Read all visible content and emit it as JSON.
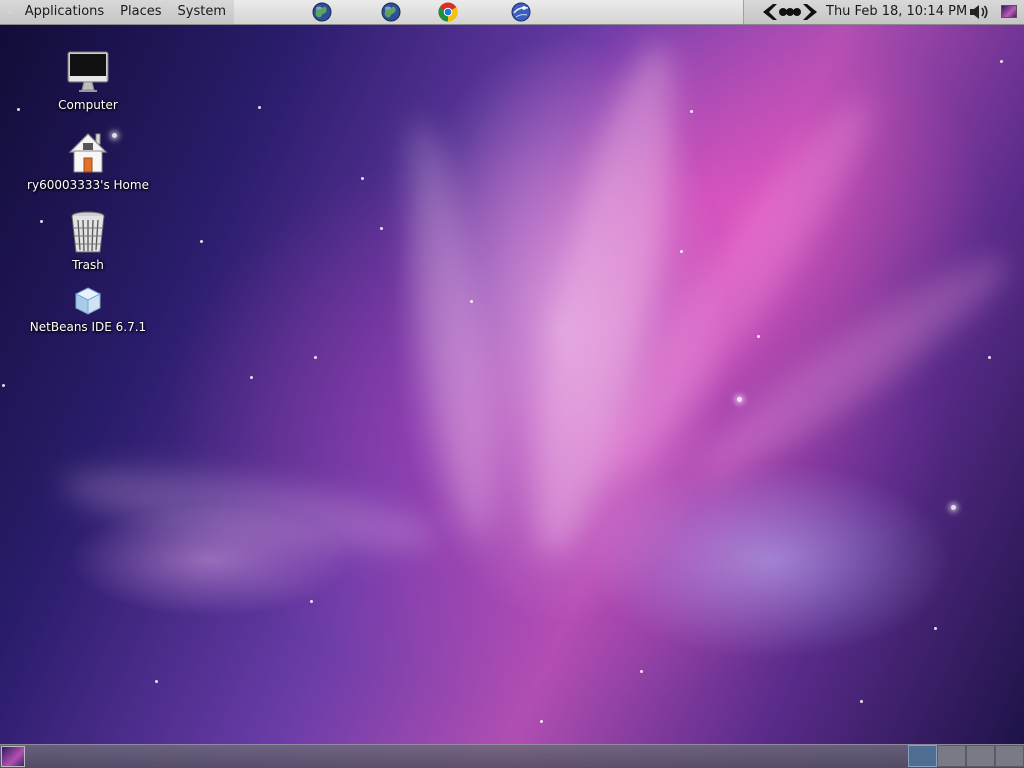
{
  "top_panel": {
    "menus": [
      "Applications",
      "Places",
      "System"
    ],
    "launchers": [
      "globe-icon",
      "globe-icon",
      "chrome-icon",
      "web-browser-icon"
    ],
    "clock": "Thu Feb 18, 10:14 PM"
  },
  "desktop_icons": [
    {
      "label": "Computer",
      "icon": "computer-icon"
    },
    {
      "label": "ry60003333's Home",
      "icon": "home-icon"
    },
    {
      "label": "Trash",
      "icon": "trash-icon"
    },
    {
      "label": "NetBeans IDE 6.7.1",
      "icon": "netbeans-icon"
    }
  ],
  "bottom_panel": {
    "workspace_count": 4,
    "active_workspace": 1
  },
  "colors": {
    "panel": "#d6d6d6",
    "wallpaper_primary": "#b14eb3",
    "wallpaper_dark": "#1b1245",
    "active_workspace": "#4f6d92"
  }
}
